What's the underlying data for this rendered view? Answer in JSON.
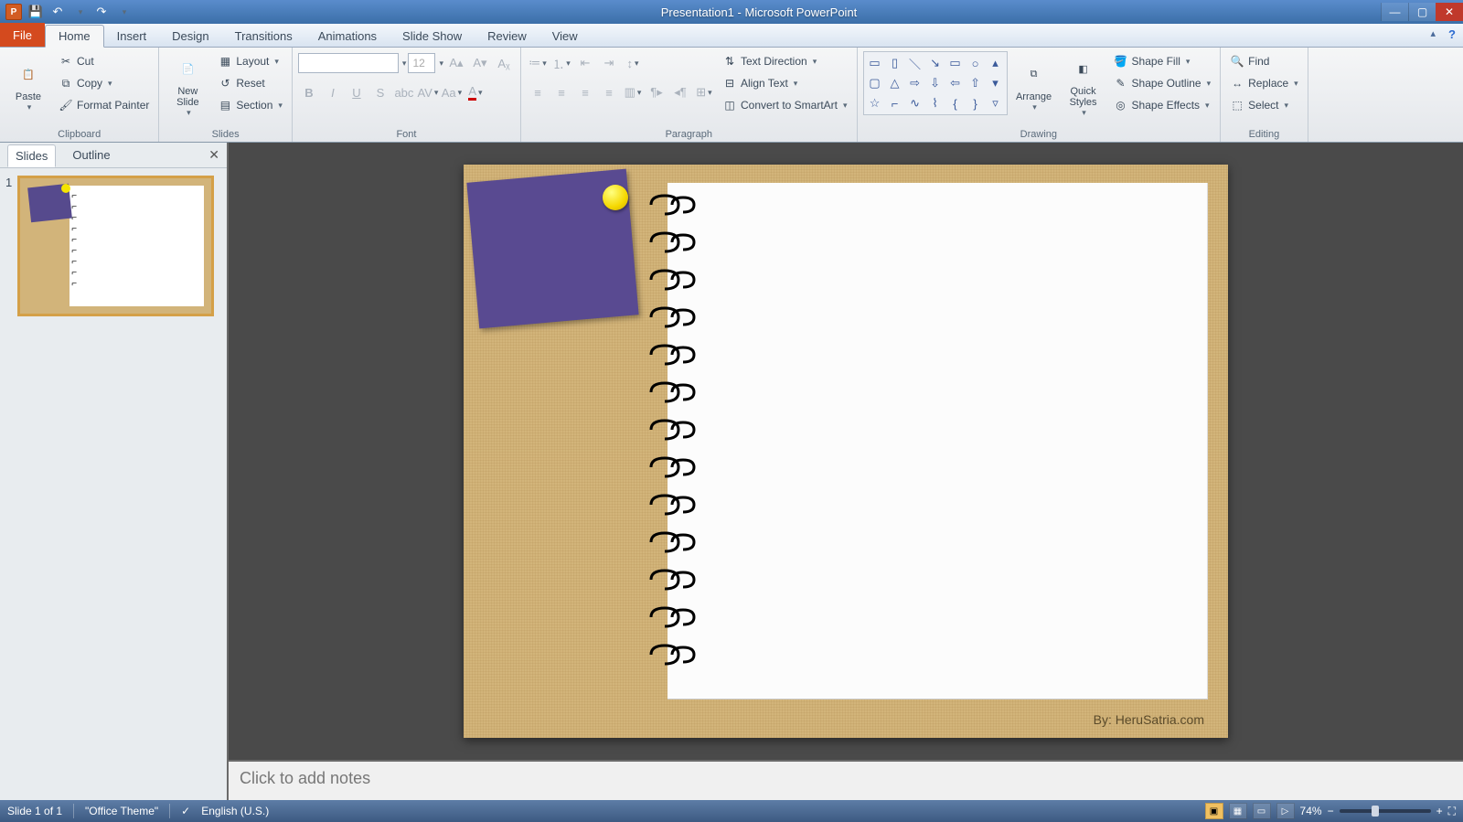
{
  "title": "Presentation1 - Microsoft PowerPoint",
  "tabs": {
    "file": "File",
    "home": "Home",
    "insert": "Insert",
    "design": "Design",
    "transitions": "Transitions",
    "animations": "Animations",
    "slideshow": "Slide Show",
    "review": "Review",
    "view": "View"
  },
  "ribbon": {
    "clipboard": {
      "label": "Clipboard",
      "paste": "Paste",
      "cut": "Cut",
      "copy": "Copy",
      "format_painter": "Format Painter"
    },
    "slides": {
      "label": "Slides",
      "new_slide": "New\nSlide",
      "layout": "Layout",
      "reset": "Reset",
      "section": "Section"
    },
    "font": {
      "label": "Font",
      "name": "",
      "size": "12"
    },
    "paragraph": {
      "label": "Paragraph",
      "text_direction": "Text Direction",
      "align_text": "Align Text",
      "convert_smartart": "Convert to SmartArt"
    },
    "drawing": {
      "label": "Drawing",
      "arrange": "Arrange",
      "quick_styles": "Quick\nStyles",
      "shape_fill": "Shape Fill",
      "shape_outline": "Shape Outline",
      "shape_effects": "Shape Effects"
    },
    "editing": {
      "label": "Editing",
      "find": "Find",
      "replace": "Replace",
      "select": "Select"
    }
  },
  "panel": {
    "slides_tab": "Slides",
    "outline_tab": "Outline",
    "thumb_number": "1"
  },
  "slide": {
    "byline": "By: HeruSatria.com"
  },
  "notes_placeholder": "Click to add notes",
  "status": {
    "slide_info": "Slide 1 of 1",
    "theme": "\"Office Theme\"",
    "language": "English (U.S.)",
    "zoom": "74%"
  }
}
